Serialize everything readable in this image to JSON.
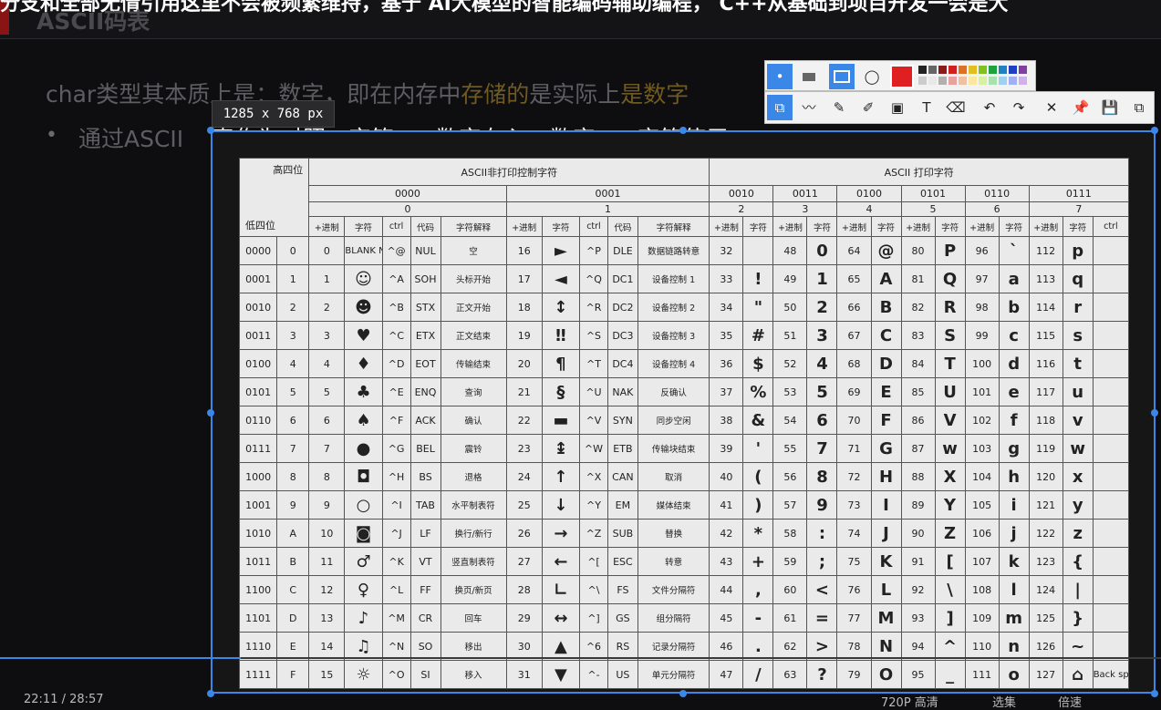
{
  "top_caption": "分支和全部无情引用这里不会被频繁维持，基于 AI大模型的智能编码辅助编程， C++从基础到项目开发一会是大",
  "slide_title": "ASCII码表",
  "line1_pre": "char类型其本质上是：数字，即在内存中",
  "line1_hl1": "存储的",
  "line1_mid": "是实际上",
  "line1_hl2": "是数字",
  "bullet": "•",
  "line2_a": "通过ASCII",
  "line2_b": "表作为对照，字符 -> 数字存入，数字 -> 字符使用",
  "size_tip": "1285 x 768  px",
  "table": {
    "corner_hi": "高四位",
    "corner_lo": "低四位",
    "group_left": "ASCII非打印控制字符",
    "group_right": "ASCII 打印字符",
    "nibbles": [
      "0000",
      "0001",
      "0010",
      "0011",
      "0100",
      "0101",
      "0110",
      "0111"
    ],
    "digits": [
      "0",
      "1",
      "2",
      "3",
      "4",
      "5",
      "6",
      "7"
    ],
    "h_dec": "+进制",
    "h_char": "字符",
    "h_ctrl": "ctrl",
    "h_code": "代码",
    "h_desc": "字符解释",
    "rows": [
      {
        "bin": "0000",
        "hex": "0",
        "d0": "0",
        "c0": "BLANK NULL",
        "k0": "^@",
        "code0": "NUL",
        "x0": "空",
        "d1": "16",
        "c1": "►",
        "k1": "^P",
        "code1": "DLE",
        "x1": "数据链路转意",
        "d2": "32",
        "c2": "",
        "d3": "48",
        "c3": "0",
        "d4": "64",
        "c4": "@",
        "d5": "80",
        "c5": "P",
        "d6": "96",
        "c6": "`",
        "d7": "112",
        "c7": "p",
        "k7": ""
      },
      {
        "bin": "0001",
        "hex": "1",
        "d0": "1",
        "c0": "☺",
        "k0": "^A",
        "code0": "SOH",
        "x0": "头标开始",
        "d1": "17",
        "c1": "◄",
        "k1": "^Q",
        "code1": "DC1",
        "x1": "设备控制 1",
        "d2": "33",
        "c2": "!",
        "d3": "49",
        "c3": "1",
        "d4": "65",
        "c4": "A",
        "d5": "81",
        "c5": "Q",
        "d6": "97",
        "c6": "a",
        "d7": "113",
        "c7": "q",
        "k7": ""
      },
      {
        "bin": "0010",
        "hex": "2",
        "d0": "2",
        "c0": "☻",
        "k0": "^B",
        "code0": "STX",
        "x0": "正文开始",
        "d1": "18",
        "c1": "↕",
        "k1": "^R",
        "code1": "DC2",
        "x1": "设备控制 2",
        "d2": "34",
        "c2": "\"",
        "d3": "50",
        "c3": "2",
        "d4": "66",
        "c4": "B",
        "d5": "82",
        "c5": "R",
        "d6": "98",
        "c6": "b",
        "d7": "114",
        "c7": "r",
        "k7": ""
      },
      {
        "bin": "0011",
        "hex": "3",
        "d0": "3",
        "c0": "♥",
        "k0": "^C",
        "code0": "ETX",
        "x0": "正文结束",
        "d1": "19",
        "c1": "‼",
        "k1": "^S",
        "code1": "DC3",
        "x1": "设备控制 3",
        "d2": "35",
        "c2": "#",
        "d3": "51",
        "c3": "3",
        "d4": "67",
        "c4": "C",
        "d5": "83",
        "c5": "S",
        "d6": "99",
        "c6": "c",
        "d7": "115",
        "c7": "s",
        "k7": ""
      },
      {
        "bin": "0100",
        "hex": "4",
        "d0": "4",
        "c0": "♦",
        "k0": "^D",
        "code0": "EOT",
        "x0": "传输结束",
        "d1": "20",
        "c1": "¶",
        "k1": "^T",
        "code1": "DC4",
        "x1": "设备控制 4",
        "d2": "36",
        "c2": "$",
        "d3": "52",
        "c3": "4",
        "d4": "68",
        "c4": "D",
        "d5": "84",
        "c5": "T",
        "d6": "100",
        "c6": "d",
        "d7": "116",
        "c7": "t",
        "k7": ""
      },
      {
        "bin": "0101",
        "hex": "5",
        "d0": "5",
        "c0": "♣",
        "k0": "^E",
        "code0": "ENQ",
        "x0": "查询",
        "d1": "21",
        "c1": "§",
        "k1": "^U",
        "code1": "NAK",
        "x1": "反确认",
        "d2": "37",
        "c2": "%",
        "d3": "53",
        "c3": "5",
        "d4": "69",
        "c4": "E",
        "d5": "85",
        "c5": "U",
        "d6": "101",
        "c6": "e",
        "d7": "117",
        "c7": "u",
        "k7": ""
      },
      {
        "bin": "0110",
        "hex": "6",
        "d0": "6",
        "c0": "♠",
        "k0": "^F",
        "code0": "ACK",
        "x0": "确认",
        "d1": "22",
        "c1": "▬",
        "k1": "^V",
        "code1": "SYN",
        "x1": "同步空闲",
        "d2": "38",
        "c2": "&",
        "d3": "54",
        "c3": "6",
        "d4": "70",
        "c4": "F",
        "d5": "86",
        "c5": "V",
        "d6": "102",
        "c6": "f",
        "d7": "118",
        "c7": "v",
        "k7": ""
      },
      {
        "bin": "0111",
        "hex": "7",
        "d0": "7",
        "c0": "●",
        "k0": "^G",
        "code0": "BEL",
        "x0": "震铃",
        "d1": "23",
        "c1": "↨",
        "k1": "^W",
        "code1": "ETB",
        "x1": "传输块结束",
        "d2": "39",
        "c2": "'",
        "d3": "55",
        "c3": "7",
        "d4": "71",
        "c4": "G",
        "d5": "87",
        "c5": "w",
        "d6": "103",
        "c6": "g",
        "d7": "119",
        "c7": "w",
        "k7": ""
      },
      {
        "bin": "1000",
        "hex": "8",
        "d0": "8",
        "c0": "◘",
        "k0": "^H",
        "code0": "BS",
        "x0": "退格",
        "d1": "24",
        "c1": "↑",
        "k1": "^X",
        "code1": "CAN",
        "x1": "取消",
        "d2": "40",
        "c2": "(",
        "d3": "56",
        "c3": "8",
        "d4": "72",
        "c4": "H",
        "d5": "88",
        "c5": "X",
        "d6": "104",
        "c6": "h",
        "d7": "120",
        "c7": "x",
        "k7": ""
      },
      {
        "bin": "1001",
        "hex": "9",
        "d0": "9",
        "c0": "○",
        "k0": "^I",
        "code0": "TAB",
        "x0": "水平制表符",
        "d1": "25",
        "c1": "↓",
        "k1": "^Y",
        "code1": "EM",
        "x1": "媒体结束",
        "d2": "41",
        "c2": ")",
        "d3": "57",
        "c3": "9",
        "d4": "73",
        "c4": "I",
        "d5": "89",
        "c5": "Y",
        "d6": "105",
        "c6": "i",
        "d7": "121",
        "c7": "y",
        "k7": ""
      },
      {
        "bin": "1010",
        "hex": "A",
        "d0": "10",
        "c0": "◙",
        "k0": "^J",
        "code0": "LF",
        "x0": "换行/新行",
        "d1": "26",
        "c1": "→",
        "k1": "^Z",
        "code1": "SUB",
        "x1": "替换",
        "d2": "42",
        "c2": "*",
        "d3": "58",
        "c3": ":",
        "d4": "74",
        "c4": "J",
        "d5": "90",
        "c5": "Z",
        "d6": "106",
        "c6": "j",
        "d7": "122",
        "c7": "z",
        "k7": ""
      },
      {
        "bin": "1011",
        "hex": "B",
        "d0": "11",
        "c0": "♂",
        "k0": "^K",
        "code0": "VT",
        "x0": "竖直制表符",
        "d1": "27",
        "c1": "←",
        "k1": "^[",
        "code1": "ESC",
        "x1": "转意",
        "d2": "43",
        "c2": "+",
        "d3": "59",
        "c3": ";",
        "d4": "75",
        "c4": "K",
        "d5": "91",
        "c5": "[",
        "d6": "107",
        "c6": "k",
        "d7": "123",
        "c7": "{",
        "k7": ""
      },
      {
        "bin": "1100",
        "hex": "C",
        "d0": "12",
        "c0": "♀",
        "k0": "^L",
        "code0": "FF",
        "x0": "换页/新页",
        "d1": "28",
        "c1": "∟",
        "k1": "^\\",
        "code1": "FS",
        "x1": "文件分隔符",
        "d2": "44",
        "c2": ",",
        "d3": "60",
        "c3": "<",
        "d4": "76",
        "c4": "L",
        "d5": "92",
        "c5": "\\",
        "d6": "108",
        "c6": "l",
        "d7": "124",
        "c7": "|",
        "k7": ""
      },
      {
        "bin": "1101",
        "hex": "D",
        "d0": "13",
        "c0": "♪",
        "k0": "^M",
        "code0": "CR",
        "x0": "回车",
        "d1": "29",
        "c1": "↔",
        "k1": "^]",
        "code1": "GS",
        "x1": "组分隔符",
        "d2": "45",
        "c2": "-",
        "d3": "61",
        "c3": "=",
        "d4": "77",
        "c4": "M",
        "d5": "93",
        "c5": "]",
        "d6": "109",
        "c6": "m",
        "d7": "125",
        "c7": "}",
        "k7": ""
      },
      {
        "bin": "1110",
        "hex": "E",
        "d0": "14",
        "c0": "♫",
        "k0": "^N",
        "code0": "SO",
        "x0": "移出",
        "d1": "30",
        "c1": "▲",
        "k1": "^6",
        "code1": "RS",
        "x1": "记录分隔符",
        "d2": "46",
        "c2": ".",
        "d3": "62",
        "c3": ">",
        "d4": "78",
        "c4": "N",
        "d5": "94",
        "c5": "^",
        "d6": "110",
        "c6": "n",
        "d7": "126",
        "c7": "~",
        "k7": ""
      },
      {
        "bin": "1111",
        "hex": "F",
        "d0": "15",
        "c0": "☼",
        "k0": "^O",
        "code0": "SI",
        "x0": "移入",
        "d1": "31",
        "c1": "▼",
        "k1": "^-",
        "code1": "US",
        "x1": "单元分隔符",
        "d2": "47",
        "c2": "/",
        "d3": "63",
        "c3": "?",
        "d4": "79",
        "c4": "O",
        "d5": "95",
        "c5": "_",
        "d6": "111",
        "c6": "o",
        "d7": "127",
        "c7": "⌂",
        "k7": "Back space"
      }
    ]
  },
  "colors": {
    "selection": "#3b87e8",
    "palette": [
      "#e02020",
      "#222222",
      "#666666",
      "#8b1a1a",
      "#d02020",
      "#e07020",
      "#e0c020",
      "#80c020",
      "#20a040",
      "#2080c0",
      "#2040c0",
      "#8040a0",
      "#cccccc",
      "#e8e8e8",
      "#b0b0b0",
      "#e8a0a0",
      "#f0c0a0",
      "#f8e8a0",
      "#d8f0a0",
      "#a8e0b0",
      "#a0d0f0",
      "#a0b0f0",
      "#d0b0e8"
    ]
  },
  "toolbar": {
    "icons": [
      "dot-icon",
      "rect-fill-icon",
      "rect-icon",
      "ellipse-icon",
      "color-swatch-icon"
    ],
    "icons2": [
      "capture-icon",
      "polyline-icon",
      "pencil-icon",
      "marker-icon",
      "mosaic-icon",
      "text-icon",
      "eraser-icon",
      "undo-icon",
      "redo-icon",
      "close-icon",
      "pin-icon",
      "save-icon",
      "copy-icon"
    ]
  },
  "bottom": {
    "time": "22:11 / 28:57",
    "quality": "720P 高清",
    "select": "选集",
    "speed": "倍速"
  }
}
